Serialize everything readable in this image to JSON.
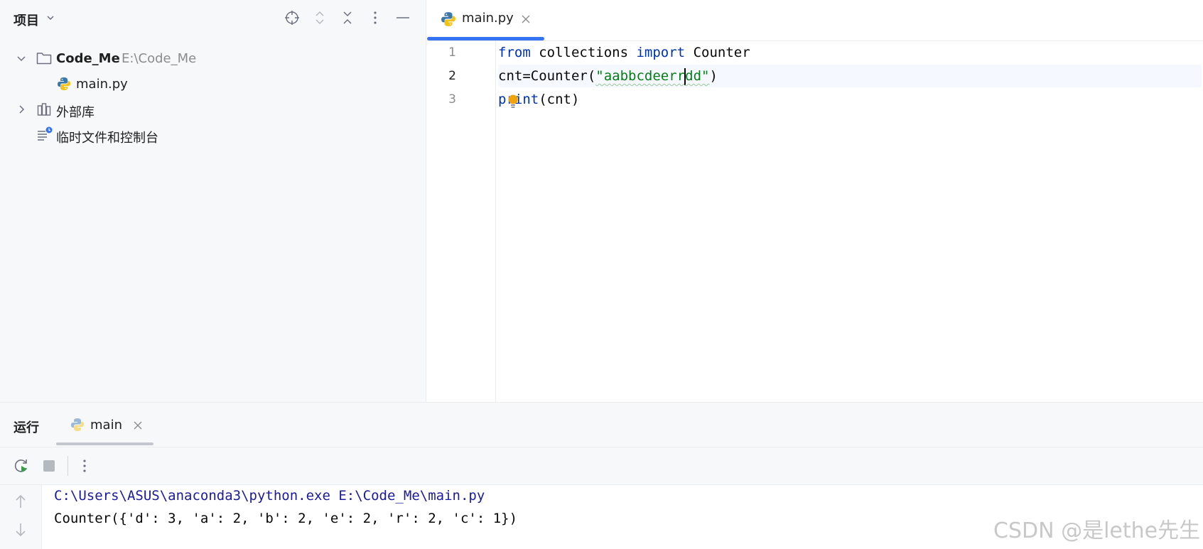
{
  "project_panel": {
    "title": "项目",
    "tree": {
      "root_name": "Code_Me",
      "root_path": "E:\\Code_Me",
      "file": "main.py",
      "external_libs": "外部库",
      "scratches": "临时文件和控制台"
    }
  },
  "editor": {
    "tab_label": "main.py",
    "line_numbers": [
      "1",
      "2",
      "3"
    ],
    "code": {
      "l1_kw1": "from",
      "l1_mod": " collections ",
      "l1_kw2": "import",
      "l1_name": " Counter",
      "l2_pre": "cnt=Counter(",
      "l2_str_a": "\"aabbcdeerr",
      "l2_str_b": "dd\"",
      "l2_post": ")",
      "l3_fn_a": "p",
      "l3_fn_b": "rint",
      "l3_post": "(cnt)"
    }
  },
  "run_panel": {
    "title": "运行",
    "tab_label": "main",
    "output": [
      "C:\\Users\\ASUS\\anaconda3\\python.exe E:\\Code_Me\\main.py",
      "Counter({'d': 3, 'a': 2, 'b': 2, 'e': 2, 'r': 2, 'c': 1})"
    ]
  },
  "watermark": "CSDN @是lethe先生",
  "colors": {
    "accent": "#3574f0",
    "keyword": "#0033b3",
    "string": "#067d17",
    "command": "#1a1a9c"
  },
  "icons": [
    "chevron-down-icon",
    "target-icon",
    "expand-all-icon",
    "collapse-all-icon",
    "more-vert-icon",
    "minimize-icon",
    "folder-icon",
    "python-file-icon",
    "library-icon",
    "scratches-icon",
    "close-icon",
    "rerun-icon",
    "stop-icon",
    "arrow-up-icon",
    "arrow-down-icon",
    "bulb-icon"
  ]
}
